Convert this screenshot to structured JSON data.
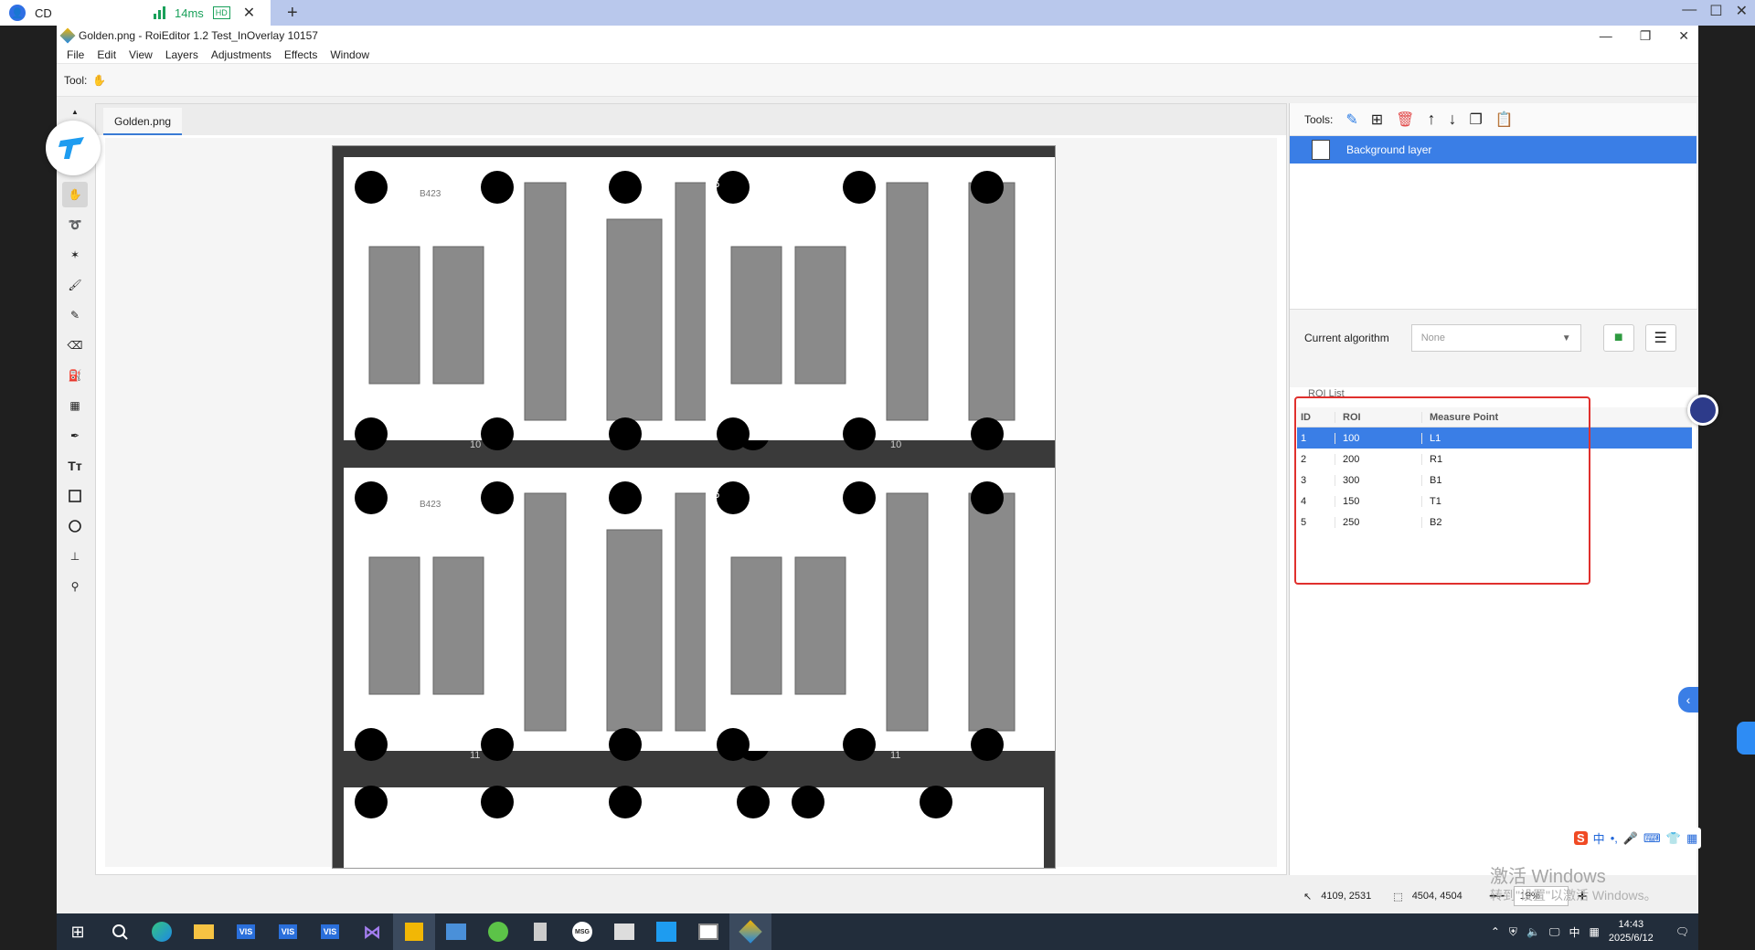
{
  "client": {
    "name": "CD",
    "latency": "14ms",
    "quality_badge": "HD",
    "new_tab": "+"
  },
  "app": {
    "title": "Golden.png - RoiEditor 1.2 Test_InOverlay 10157",
    "menu": [
      "File",
      "Edit",
      "View",
      "Layers",
      "Adjustments",
      "Effects",
      "Window"
    ],
    "tool_label": "Tool:",
    "doc_tab": "Golden.png"
  },
  "layers": {
    "tools_label": "Tools:",
    "items": [
      "Background layer"
    ]
  },
  "algorithm": {
    "label": "Current algorithm",
    "value": "None"
  },
  "roi": {
    "label": "ROI List",
    "headers": [
      "ID",
      "ROI",
      "Measure Point"
    ],
    "rows": [
      {
        "id": "1",
        "roi": "100",
        "point": "L1"
      },
      {
        "id": "2",
        "roi": "200",
        "point": "R1"
      },
      {
        "id": "3",
        "roi": "300",
        "point": "B1"
      },
      {
        "id": "4",
        "roi": "150",
        "point": "T1"
      },
      {
        "id": "5",
        "roi": "250",
        "point": "B2"
      }
    ],
    "selected_index": 0
  },
  "status": {
    "cursor": "4109, 2531",
    "size": "4504, 4504",
    "zoom": "19%"
  },
  "watermark": {
    "title": "激活 Windows",
    "subtitle": "转到\"设置\"以激活 Windows。"
  },
  "board_labels": [
    "B423",
    "26",
    "10",
    "11",
    "B423",
    "26",
    "10",
    "11"
  ],
  "taskbar": {
    "time": "14:43",
    "date": "2025/6/12",
    "ime": "中"
  },
  "colors": {
    "accent": "#3a7ee6",
    "highlight": "#e0302d",
    "taskbar": "#222d3b"
  }
}
